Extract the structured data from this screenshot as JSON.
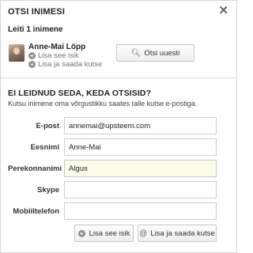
{
  "dialog": {
    "title": "OTSI INIMESI",
    "close_glyph": "✕"
  },
  "results": {
    "found_text": "Leiti 1 inimene",
    "person": {
      "name": "Anne-Mai Löpp",
      "add_link": "Lisa see isik",
      "add_invite_link": "Lisa ja saada kutse"
    },
    "search_again_label": "Otsi uuesti"
  },
  "invite": {
    "title": "EI LEIDNUD SEDA, KEDA OTSISID?",
    "subtitle": "Kutsu inimene oma võrgustikku saates talle kutse e-postiga.",
    "fields": [
      {
        "label": "E-post",
        "value": "annemai@upsteem.com"
      },
      {
        "label": "Eesnimi",
        "value": "Anne-Mai"
      },
      {
        "label": "Perekonnanimi",
        "value": "Algus"
      },
      {
        "label": "Skype",
        "value": ""
      },
      {
        "label": "Mobiiltelefon",
        "value": ""
      }
    ],
    "add_button": "Lisa see isik",
    "add_invite_button": "Lisa ja saada kutse"
  },
  "icons": {
    "plus": "+",
    "search": "🔍︎",
    "at": "@"
  }
}
